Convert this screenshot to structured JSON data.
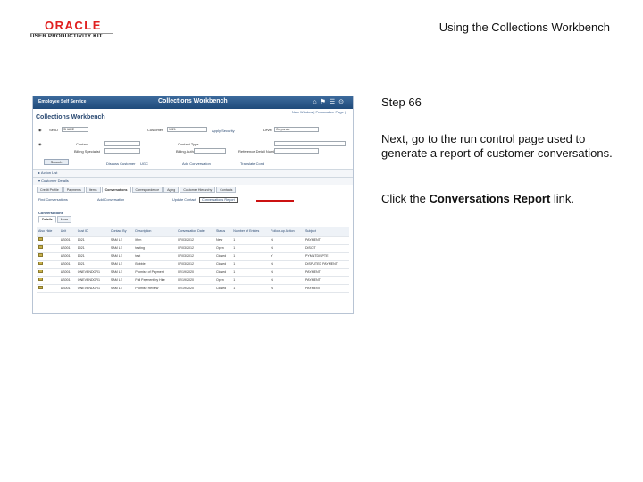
{
  "header": {
    "brand": "ORACLE",
    "brand_sub": "USER PRODUCTIVITY KIT",
    "doc_title": "Using the Collections Workbench"
  },
  "screenshot": {
    "banner_home": "Employee Self Service",
    "banner_title": "Collections Workbench",
    "top_links": "New Window | Personalize Page |",
    "page_title": "Collections Workbench",
    "search_row1": {
      "unit_label": "SetID",
      "unit_value": "SHARE",
      "customer_label": "Customer",
      "customer_value": "1021",
      "apply_label": "Apply Security",
      "level_label": "Level",
      "level_value": "Corporate"
    },
    "search_row2": {
      "contact_label": "Contact",
      "contact_type_label": "Contact Type"
    },
    "search_row3": {
      "billing_specialist_label": "Billing Specialist",
      "billing_authority_label": "Billing Authority",
      "ref_label": "Reference Detail Number"
    },
    "search_button": "Search",
    "tabs_top": [
      "Discuss Customer",
      "UGC",
      "Add Conversation",
      "Translate Cond"
    ],
    "section_action": "Action List",
    "section_customer": "Customer Details",
    "tabs": [
      "Credit Profile",
      "Payments",
      "Items",
      "Conversations",
      "Correspondence",
      "Aging",
      "Customer Hierarchy",
      "Contacts"
    ],
    "sub_links": [
      "Find Conversations",
      "Add Conversation",
      "Update Contact",
      "Conversations Report"
    ],
    "grid_title": "Conversations",
    "grid_tabs": [
      "Details",
      "More"
    ],
    "columns": [
      "Also Hide",
      "Unit",
      "Cust ID",
      "Contact By",
      "Description",
      "Conversation Date",
      "Status",
      "Number of Entries",
      "Follow-up Action",
      "Subject"
    ],
    "rows": [
      [
        "US001",
        "1021",
        "SAM LE",
        "Ifirm",
        "07/03/2012",
        "New",
        "1",
        "N",
        "PAYMENT"
      ],
      [
        "US001",
        "1021",
        "SAM LE",
        "testing",
        "07/03/2012",
        "Open",
        "1",
        "N",
        "DISCIT"
      ],
      [
        "US001",
        "1021",
        "SAM LE",
        "test",
        "07/03/2012",
        "Closed",
        "1",
        "Y",
        "PYMNTDISPTE"
      ],
      [
        "US001",
        "1021",
        "SAM LE",
        "Bobble",
        "07/03/2012",
        "Closed",
        "1",
        "N",
        "DISPUTED PAYMENT"
      ],
      [
        "US001",
        "ONEVENDOR1",
        "SAM LE",
        "Promise of Payment",
        "02/19/2020",
        "Closed",
        "1",
        "N",
        "PAYMENT"
      ],
      [
        "US001",
        "ONEVENDOR1",
        "SAM LE",
        "Full Payment by Hire",
        "02/19/2020",
        "Open",
        "1",
        "N",
        "PAYMENT"
      ],
      [
        "US001",
        "ONEVENDOR1",
        "SAM LE",
        "Promise Review",
        "02/19/2020",
        "Closed",
        "1",
        "N",
        "PAYMENT"
      ]
    ]
  },
  "instructions": {
    "step": "Step 66",
    "text": "Next, go to the run control page used to generate a report of customer conversations.",
    "click_prefix": "Click the ",
    "link_name": "Conversations Report",
    "click_suffix": " link."
  }
}
